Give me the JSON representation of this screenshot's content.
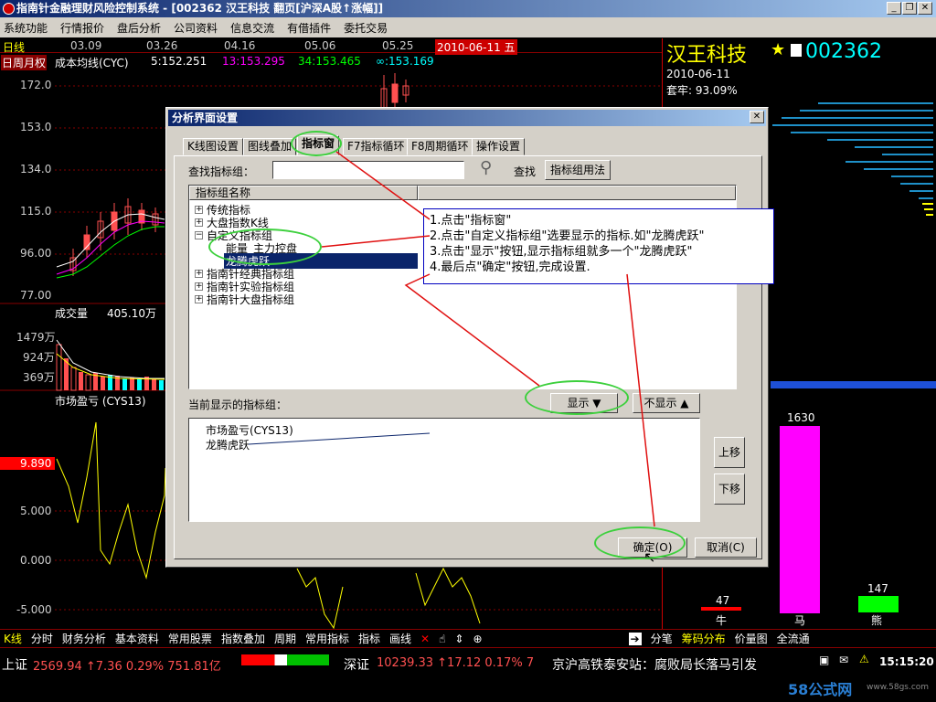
{
  "window": {
    "title": "指南针金融理财风险控制系统 - [002362 汉王科技  翻页[沪深A股↑涨幅]]"
  },
  "menu": [
    "系统功能",
    "行情报价",
    "盘后分析",
    "公司资料",
    "信息交流",
    "有借插件",
    "委托交易"
  ],
  "chart": {
    "period_label": "日线",
    "dates": [
      "03.09",
      "03.26",
      "04.16",
      "05.06",
      "05.25"
    ],
    "current_date": "2010-06-11 五",
    "period_tabs": "日周月权",
    "indicator_name": "成本均线(CYC)",
    "indicator_values": [
      "5:152.251",
      "13:153.295",
      "34:153.465",
      "∞:153.169"
    ],
    "price_axis": [
      "172.0",
      "153.0",
      "134.0",
      "115.0",
      "96.00",
      "77.00"
    ],
    "volume_label": "成交量",
    "volume_value": "405.10万",
    "volume_axis": [
      "1479万",
      "924万",
      "369万"
    ],
    "cys_label": "市场盈亏 (CYS13)",
    "cys_value": "9.890",
    "cys_axis": [
      "5.000",
      "0.000",
      "-5.000"
    ]
  },
  "right": {
    "stock_name": "汉王科技",
    "stock_code": "002362",
    "date": "2010-06-11",
    "lock_label": "套牢: 93.09%",
    "bars": [
      {
        "label": "牛",
        "value": "47"
      },
      {
        "label": "马",
        "value": "1630"
      },
      {
        "label": "熊",
        "value": "147"
      }
    ]
  },
  "dialog": {
    "title": "分析界面设置",
    "close": "✕",
    "tabs": [
      "K线图设置",
      "图线叠加",
      "指标窗",
      "F7指标循环",
      "F8周期循环",
      "操作设置"
    ],
    "search_label": "查找指标组：",
    "search_value": "",
    "search_button": "查找",
    "usage_button": "指标组用法",
    "tree_header": "指标组名称",
    "tree": [
      {
        "label": "传统指标",
        "expander": "+"
      },
      {
        "label": "大盘指数K线",
        "expander": "+"
      },
      {
        "label": "自定义指标组",
        "expander": "−"
      },
      {
        "label": "能量_主力控盘",
        "child": true
      },
      {
        "label": "龙腾虎跃",
        "child": true,
        "selected": true
      },
      {
        "label": "指南针经典指标组",
        "expander": "+"
      },
      {
        "label": "指南针实验指标组",
        "expander": "+"
      },
      {
        "label": "指南针大盘指标组",
        "expander": "+"
      }
    ],
    "current_label": "当前显示的指标组：",
    "show_button": "显示 ▼",
    "hide_button": "不显示 ▲",
    "current_list": [
      "市场盈亏(CYS13)",
      "龙腾虎跃"
    ],
    "up_button": "上移",
    "down_button": "下移",
    "ok_button": "确定(O)",
    "cancel_button": "取消(C)"
  },
  "note": [
    "1.点击\"指标窗\"",
    "2.点击\"自定义指标组\"选要显示的指标.如\"龙腾虎跃\"",
    "3.点击\"显示\"按钮,显示指标组就多一个\"龙腾虎跃\"",
    "4.最后点\"确定\"按钮,完成设置."
  ],
  "bottom_tabs": [
    "K线",
    "分时",
    "财务分析",
    "基本资料",
    "常用股票",
    "指数叠加",
    "周期",
    "常用指标",
    "指标",
    "画线"
  ],
  "bottom_right": [
    "分笔",
    "筹码分布",
    "价量图",
    "全流通"
  ],
  "status": {
    "sh_label": "上证",
    "sh_text": "2569.94 ↑7.36 0.29% 751.81亿",
    "sz_label": "深证",
    "sz_text": "10239.33 ↑17.12 0.17% 7",
    "news": "京沪高铁泰安站：腐败局长落马引发",
    "time": "15:15:20",
    "watermark": "58公式网",
    "watermark_url": "www.58gs.com"
  },
  "colors": {
    "accent": "#0a246a",
    "up": "#ff5050",
    "yellow": "#ffff00",
    "cyan": "#00ffff",
    "green": "#00ff00",
    "magenta": "#ff00ff"
  }
}
